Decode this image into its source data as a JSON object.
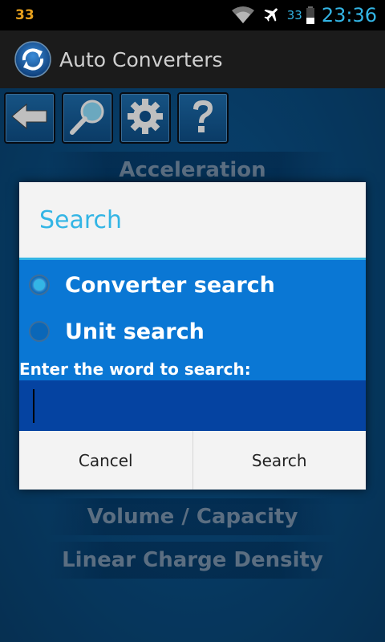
{
  "status": {
    "notification": "33",
    "battery_pct": "33",
    "time": "23:36"
  },
  "app": {
    "title": "Auto Converters"
  },
  "toolbar": {
    "back_icon": "arrow-left-icon",
    "search_icon": "magnifier-icon",
    "settings_icon": "gear-icon",
    "help_icon": "question-icon"
  },
  "list": {
    "items": [
      "Acceleration",
      "Volume / Capacity",
      "Linear Charge Density"
    ]
  },
  "dialog": {
    "title": "Search",
    "options": [
      {
        "label": "Converter search",
        "checked": true
      },
      {
        "label": "Unit search",
        "checked": false
      }
    ],
    "prompt": "Enter the word to search:",
    "input_value": "",
    "cancel_label": "Cancel",
    "search_label": "Search"
  },
  "colors": {
    "accent": "#33b5e5",
    "dialog_body": "#0a77d4",
    "input_bg": "#0543a1"
  }
}
